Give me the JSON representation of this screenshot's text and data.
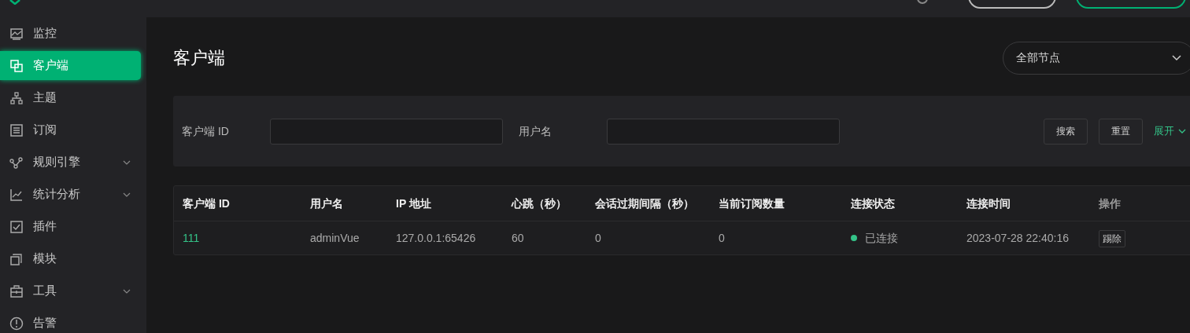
{
  "sidebar": {
    "items": [
      {
        "label": "监控",
        "kind": "monitor",
        "expandable": false,
        "selected": false
      },
      {
        "label": "客户端",
        "kind": "clients",
        "expandable": false,
        "selected": true
      },
      {
        "label": "主题",
        "kind": "topics",
        "expandable": false,
        "selected": false
      },
      {
        "label": "订阅",
        "kind": "list",
        "expandable": false,
        "selected": false
      },
      {
        "label": "规则引擎",
        "kind": "rules",
        "expandable": true,
        "selected": false
      },
      {
        "label": "统计分析",
        "kind": "chart",
        "expandable": true,
        "selected": false
      },
      {
        "label": "插件",
        "kind": "check",
        "expandable": false,
        "selected": false
      },
      {
        "label": "模块",
        "kind": "modules",
        "expandable": false,
        "selected": false
      },
      {
        "label": "工具",
        "kind": "toolbox",
        "expandable": true,
        "selected": false
      },
      {
        "label": "告警",
        "kind": "alert",
        "expandable": false,
        "selected": false
      }
    ]
  },
  "page": {
    "title": "客户端",
    "node_select": "全部节点"
  },
  "filters": {
    "fields": [
      {
        "label": "客户端 ID"
      },
      {
        "label": "用户名"
      }
    ],
    "buttons": [
      "搜索",
      "重置"
    ],
    "expand_link": "展开"
  },
  "table": {
    "columns": [
      "客户端 ID",
      "用户名",
      "IP 地址",
      "心跳（秒）",
      "会话过期间隔（秒）",
      "当前订阅数量",
      "连接状态",
      "连接时间",
      "操作"
    ],
    "rows": [
      {
        "client_id": "111",
        "username": "adminVue",
        "ip": "127.0.0.1:65426",
        "keepalive": "60",
        "expiry": "0",
        "subscriptions": "0",
        "status": {
          "text": "已连接",
          "color": "#34c388"
        },
        "connected_at": "2023-07-28 22:40:16",
        "action": "踢除"
      }
    ]
  }
}
